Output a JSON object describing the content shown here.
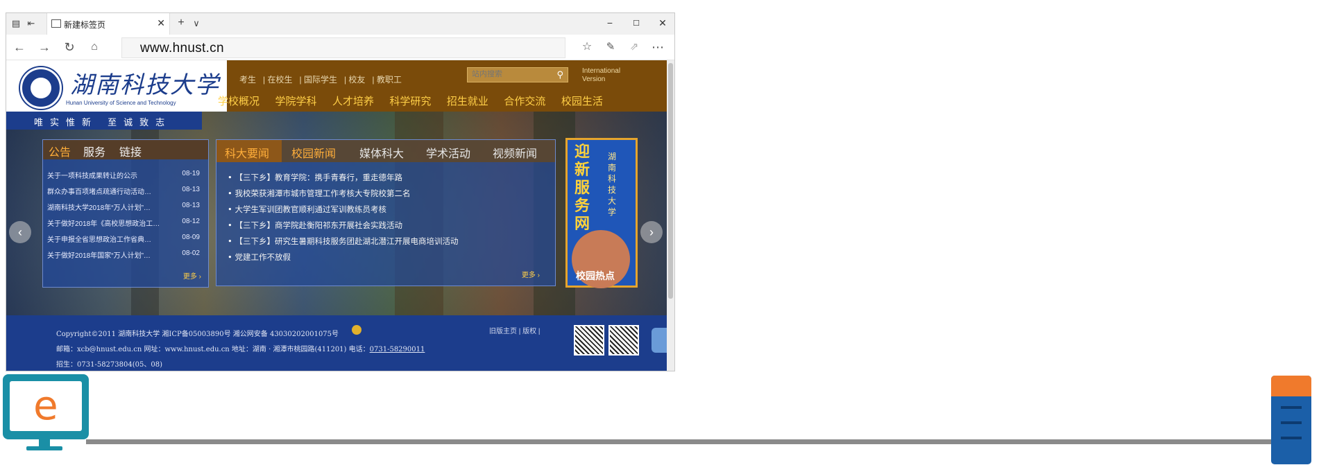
{
  "browser": {
    "tab_title": "新建标签页",
    "new_tab_label": "+",
    "tab_list_label": "∨",
    "window_buttons": [
      "−",
      "☐",
      "✕"
    ],
    "address_url": "www.hnust.cn",
    "toolbar_icons": [
      "back-icon",
      "forward-icon",
      "refresh-icon",
      "home-icon",
      "favorites-icon",
      "notes-icon",
      "share-icon",
      "more-icon"
    ]
  },
  "site": {
    "logo_name": "湖南科技大学",
    "logo_en": "Hunan University of Science and Technology",
    "motto": "唯实惟新 至诚致志",
    "top_links": [
      "考生",
      "在校生",
      "国际学生",
      "校友",
      "教职工"
    ],
    "search_placeholder": "站内搜索",
    "intl_line1": "International",
    "intl_line2": "Version",
    "nav": [
      "学校概况",
      "学院学科",
      "人才培养",
      "科学研究",
      "招生就业",
      "合作交流",
      "校园生活"
    ]
  },
  "notice": {
    "tabs": [
      "公告",
      "服务",
      "链接"
    ],
    "items": [
      {
        "title": "关于一项科技成果转让的公示",
        "date": "08-19"
      },
      {
        "title": "群众办事百项堵点疏通行动活动…",
        "date": "08-13"
      },
      {
        "title": "湖南科技大学2018年“万人计划”…",
        "date": "08-13"
      },
      {
        "title": "关于做好2018年《高校思想政治工…",
        "date": "08-12"
      },
      {
        "title": "关于申报全省思想政治工作省典…",
        "date": "08-09"
      },
      {
        "title": "关于做好2018年国家“万人计划”…",
        "date": "08-02"
      }
    ],
    "more": "更多 ›"
  },
  "news": {
    "tabs": [
      "科大要闻",
      "校园新闻",
      "媒体科大",
      "学术活动",
      "视频新闻"
    ],
    "items": [
      "【三下乡】教育学院：携手青春行，重走德年路",
      "我校荣获湘潭市城市管理工作考核大专院校第二名",
      "大学生军训团教官顺利通过军训教练员考核",
      "【三下乡】商学院赴衡阳祁东开展社会实践活动",
      "【三下乡】研究生暑期科技服务团赴湖北潜江开展电商培训活动",
      "党建工作不放假"
    ],
    "more": "更多 ›"
  },
  "welcome": {
    "big": "迎新服务网",
    "small": "湖南科技大学",
    "label": "校园热点"
  },
  "carousel": {
    "prev": "‹",
    "next": "›"
  },
  "footer": {
    "line1": "Copyright©2011 湖南科技大学 湘ICP备05003890号 湘公网安备 43030202001075号",
    "line2_prefix": "邮箱：xcb@hnust.edu.cn 网址：www.hnust.edu.cn 地址：湖南 · 湘潭市桃园路(411201) 电话：",
    "line2_phone": "0731-58290011",
    "line3": "招生：0731-58273804(05、08)",
    "links": [
      "旧版主页",
      "版权"
    ]
  },
  "graphics": {
    "monitor_letter": "e"
  }
}
